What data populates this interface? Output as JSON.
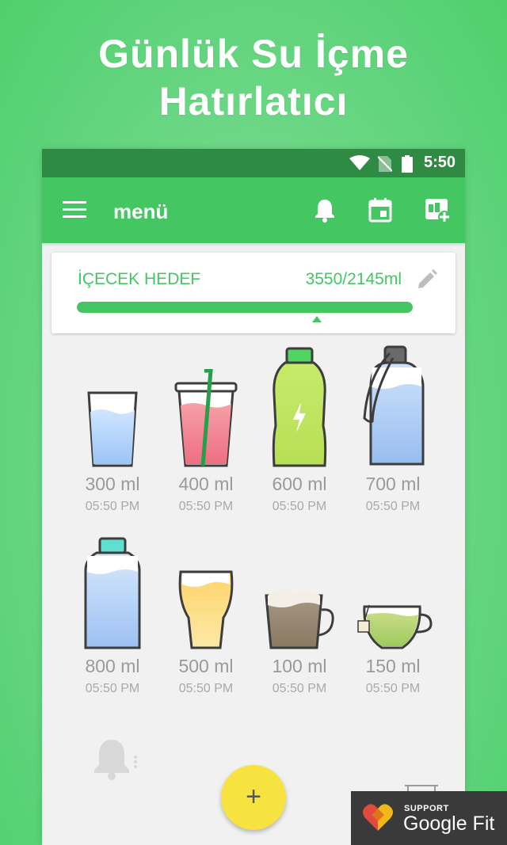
{
  "headline": [
    "Günlük Su İçme",
    "Hatırlatıcı"
  ],
  "status_bar": {
    "time": "5:50"
  },
  "app_bar": {
    "title": "menü"
  },
  "goal": {
    "label": "İÇECEK HEDEF",
    "value": "3550/2145ml",
    "progress": 1.0
  },
  "drinks": [
    {
      "amount": "300 ml",
      "time": "05:50 PM"
    },
    {
      "amount": "400 ml",
      "time": "05:50 PM"
    },
    {
      "amount": "600 ml",
      "time": "05:50 PM"
    },
    {
      "amount": "700 ml",
      "time": "05:50 PM"
    },
    {
      "amount": "800 ml",
      "time": "05:50 PM"
    },
    {
      "amount": "500 ml",
      "time": "05:50 PM"
    },
    {
      "amount": "100 ml",
      "time": "05:50 PM"
    },
    {
      "amount": "150 ml",
      "time": "05:50 PM"
    }
  ],
  "fab": {
    "label": "+"
  },
  "google_fit": {
    "support": "SUPPORT",
    "name": "Google Fit"
  },
  "colors": {
    "primary": "#44c763",
    "status_bar": "#2f8a43",
    "fab": "#f6e33f"
  }
}
